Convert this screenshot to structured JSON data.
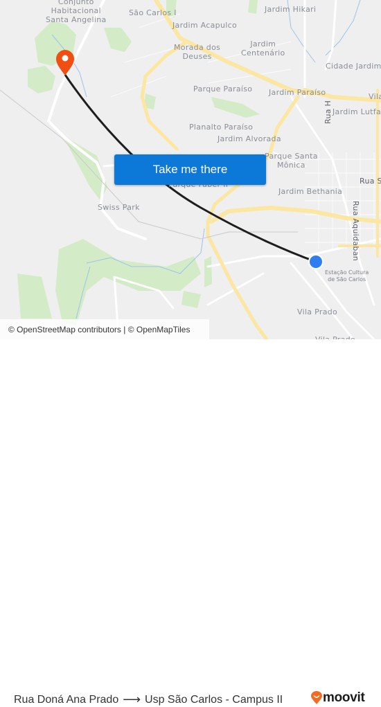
{
  "map": {
    "labels": {
      "santa_angelina": "Conjunto\nHabitacional\nSanta Angelina",
      "sao_carlos_i": "São Carlos I",
      "jardim_hikari": "Jardim Hikari",
      "jardim_acapulco": "Jardim Acapulco",
      "morada_dos_deuses": "Morada dos\nDeuses",
      "jardim_centenario": "Jardim\nCentenário",
      "cidade_jardim": "Cidade Jardim",
      "parque_paraiso": "Parque Paraíso",
      "jardim_paraiso": "Jardim Paraíso",
      "vila": "Vila",
      "rua_h": "Rua H",
      "jardim_lutfalla": "Jardim Lutfa",
      "planalto_paraiso": "Planalto Paraíso",
      "jardim_alvorada": "Jardim Alvorada",
      "parque_santa_monica": "Parque Santa\nMônica",
      "rua_s": "Rua S",
      "parque_faber_ii": "Parque Faber II",
      "jardim_bethania": "Jardim Bethania",
      "swiss_park": "Swiss Park",
      "rua_aquidaban": "Rua Aquidaban",
      "estacao_cultura": "Estação Cultura\nde São Carlos",
      "vila_prado": "Vila Prado",
      "vila_prado_2": "Vila Prado"
    },
    "origin_marker": "current-location",
    "destination_marker": "destination-pin",
    "colors": {
      "route": "#1e1e1e",
      "origin_dot": "#2f7ef0",
      "destination_pin": "#f04e12",
      "major_road": "#fbe7a4",
      "park": "#cfe8c1",
      "water": "#8fbce6"
    }
  },
  "cta": {
    "label": "Take me there"
  },
  "attribution": {
    "text": "© OpenStreetMap contributors | © OpenMapTiles"
  },
  "footer": {
    "origin": "Rua Doná Ana Prado",
    "arrow": "⟶",
    "destination": "Usp São Carlos - Campus II",
    "brand": "moovit",
    "brand_color": "#f26b21"
  }
}
